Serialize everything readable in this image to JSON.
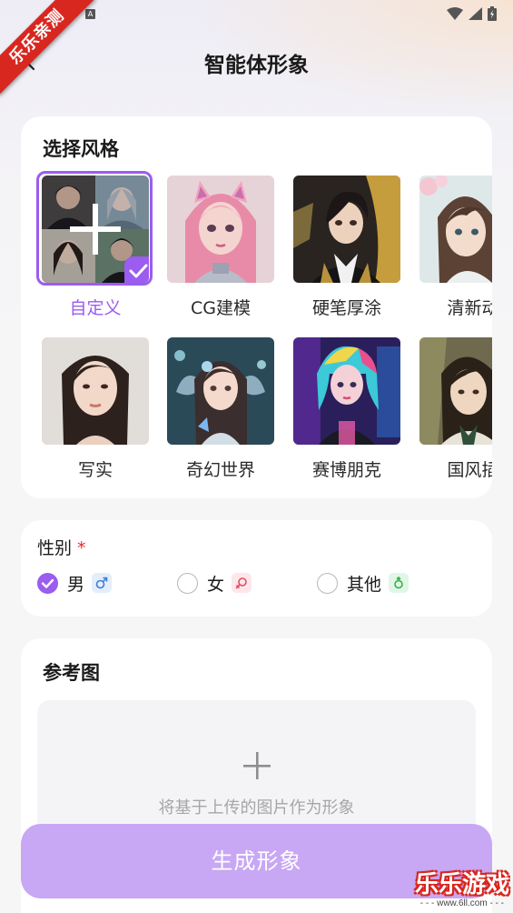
{
  "status_bar": {
    "notification_letter": "A",
    "icons": [
      "wifi-icon",
      "signal-icon",
      "battery-icon"
    ]
  },
  "header": {
    "title": "智能体形象",
    "back_icon": "chevron-left-icon"
  },
  "style_section": {
    "title": "选择风格",
    "selected_index": 0,
    "items": [
      {
        "label": "自定义"
      },
      {
        "label": "CG建模"
      },
      {
        "label": "硬笔厚涂"
      },
      {
        "label": "清新动"
      },
      {
        "label": "写实"
      },
      {
        "label": "奇幻世界"
      },
      {
        "label": "赛博朋克"
      },
      {
        "label": "国风插"
      }
    ]
  },
  "gender_section": {
    "title": "性别",
    "required_mark": "*",
    "options": [
      {
        "label": "男",
        "icon": "male-icon",
        "checked": true
      },
      {
        "label": "女",
        "icon": "female-icon",
        "checked": false
      },
      {
        "label": "其他",
        "icon": "other-gender-icon",
        "checked": false
      }
    ]
  },
  "reference_section": {
    "title": "参考图",
    "upload_hint": "将基于上传的图片作为形象"
  },
  "generate_button": {
    "label": "生成形象"
  },
  "ribbon": {
    "text": "乐乐亲测"
  },
  "watermark": {
    "title": "乐乐游戏",
    "subtitle": "- - - www.6ll.com - - -"
  },
  "colors": {
    "accent": "#9b5cf0",
    "button": "#c8a7f4",
    "required": "#e0322a"
  }
}
